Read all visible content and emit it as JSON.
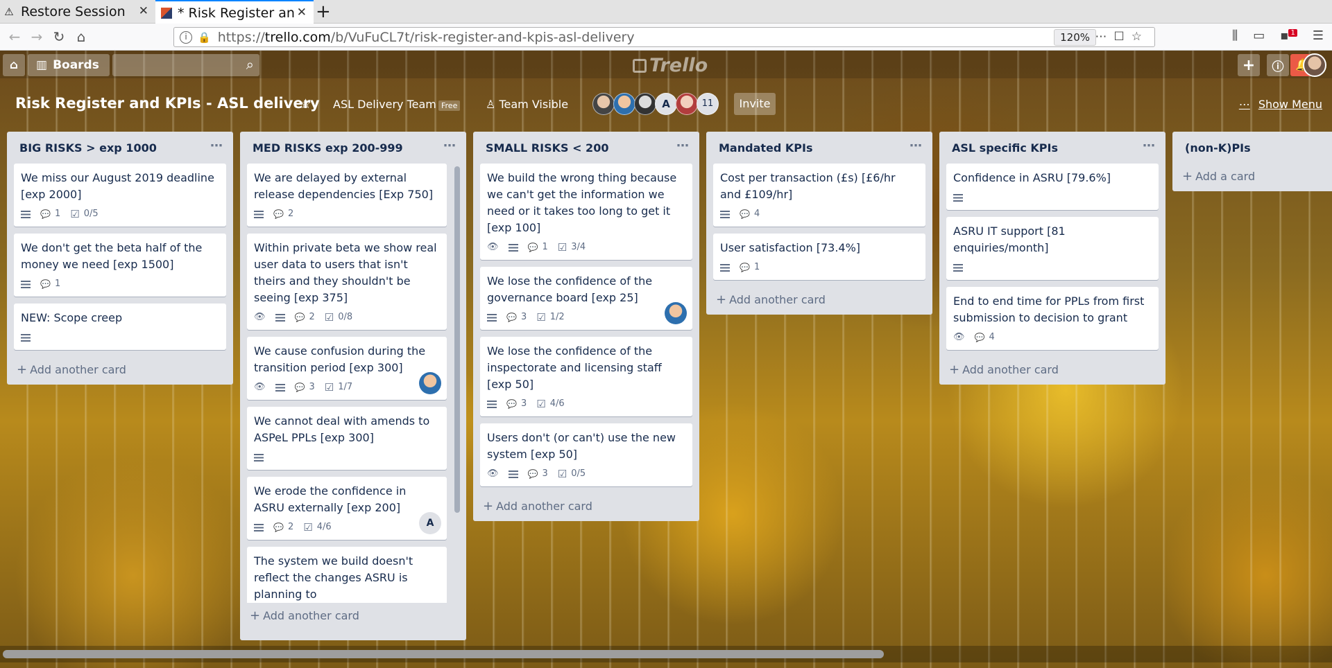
{
  "browser": {
    "tabs": [
      {
        "label": "Restore Session",
        "active": false
      },
      {
        "label": "* Risk Register and KPIs - ASL delivery",
        "active": true
      }
    ],
    "url_prefix": "https://",
    "url_domain": "trello.com",
    "url_path": "/b/VuFuCL7t/risk-register-and-kpis-asl-delivery",
    "zoom": "120%"
  },
  "header": {
    "boards_label": "Boards",
    "logo": "Trello"
  },
  "board": {
    "title": "Risk Register and KPIs - ASL delivery",
    "team": "ASL Delivery Team",
    "team_badge": "Free",
    "visibility": "Team Visible",
    "member_letter": "A",
    "member_more": "11",
    "invite": "Invite",
    "show_menu": "Show Menu"
  },
  "lists": [
    {
      "title": "BIG RISKS > exp 1000",
      "add": "Add another card",
      "cards": [
        {
          "title": "We miss our August 2019 deadline [exp 2000]",
          "desc": true,
          "comments": "1",
          "checklist": "0/5"
        },
        {
          "title": "We don't get the beta half of the money we need [exp 1500]",
          "desc": true,
          "comments": "1"
        },
        {
          "title": "NEW: Scope creep",
          "desc": true
        }
      ]
    },
    {
      "title": "MED RISKS exp 200-999",
      "add": "Add another card",
      "cards": [
        {
          "title": "We are delayed by external release dependencies [Exp 750]",
          "desc": true,
          "comments": "2"
        },
        {
          "title": "Within private beta we show real user data to users that isn't theirs and they shouldn't be seeing [exp 375]",
          "watch": true,
          "desc": true,
          "comments": "2",
          "checklist": "0/8"
        },
        {
          "title": "We cause confusion during the transition period [exp 300]",
          "watch": true,
          "desc": true,
          "comments": "3",
          "checklist": "1/7",
          "member": "photo"
        },
        {
          "title": "We cannot deal with amends to ASPeL PPLs [exp 300]",
          "desc": true
        },
        {
          "title": "We erode the confidence in ASRU externally [exp 200]",
          "desc": true,
          "comments": "2",
          "checklist": "4/6",
          "member": "A"
        },
        {
          "title": "The system we build doesn't reflect the changes ASRU is planning to",
          "partial": true
        }
      ]
    },
    {
      "title": "SMALL RISKS < 200",
      "add": "Add another card",
      "cards": [
        {
          "title": "We build the wrong thing because we can't get the information we need or it takes too long to get it [exp 100]",
          "watch": true,
          "desc": true,
          "comments": "1",
          "checklist": "3/4"
        },
        {
          "title": "We lose the confidence of the governance board [exp 25]",
          "desc": true,
          "comments": "3",
          "checklist": "1/2",
          "member": "photo"
        },
        {
          "title": "We lose the confidence of the inspectorate and licensing staff [exp 50]",
          "desc": true,
          "comments": "3",
          "checklist": "4/6"
        },
        {
          "title": "Users don't (or can't) use the new system [exp 50]",
          "watch": true,
          "desc": true,
          "comments": "3",
          "checklist": "0/5"
        }
      ]
    },
    {
      "title": "Mandated KPIs",
      "add": "Add another card",
      "cards": [
        {
          "title": "Cost per transaction (£s) [£6/hr and £109/hr]",
          "desc": true,
          "comments": "4"
        },
        {
          "title": "User satisfaction [73.4%]",
          "desc": true,
          "comments": "1"
        }
      ]
    },
    {
      "title": "ASL specific KPIs",
      "add": "Add another card",
      "cards": [
        {
          "title": "Confidence in ASRU [79.6%]",
          "desc": true
        },
        {
          "title": "ASRU IT support [81 enquiries/month]",
          "desc": true
        },
        {
          "title": "End to end time for PPLs from first submission to decision to grant",
          "watch": true,
          "comments": "4"
        }
      ]
    },
    {
      "title": "(non-K)PIs",
      "add": "Add a card",
      "cards": []
    }
  ]
}
